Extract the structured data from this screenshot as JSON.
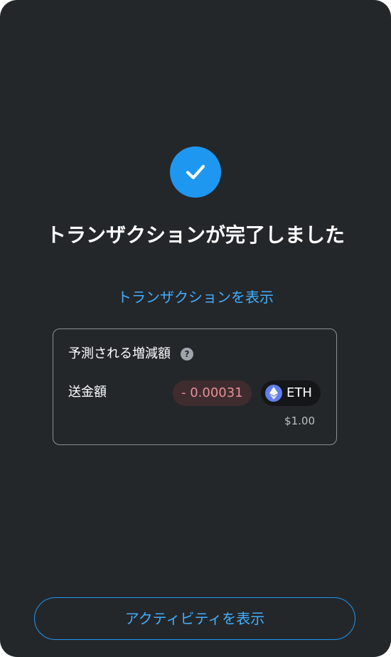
{
  "status": {
    "icon": "checkmark-icon",
    "title": "トランザクションが完了しました",
    "view_transaction_link": "トランザクションを表示"
  },
  "estimated_changes": {
    "header": "予測される増減額",
    "help_icon": "question-mark-icon",
    "help_glyph": "?",
    "rows": [
      {
        "label": "送金額",
        "amount": "- 0.00031",
        "token_icon": "ethereum-icon",
        "token": "ETH",
        "fiat_value": "$1.00"
      }
    ]
  },
  "footer": {
    "view_activity_button": "アクティビティを表示"
  },
  "colors": {
    "background": "#24272a",
    "accent": "#1e97f1",
    "link": "#43aefc",
    "negative_amount_text": "#e88f97",
    "negative_amount_bg": "#3e2c2f",
    "eth_brand": "#627eea"
  }
}
